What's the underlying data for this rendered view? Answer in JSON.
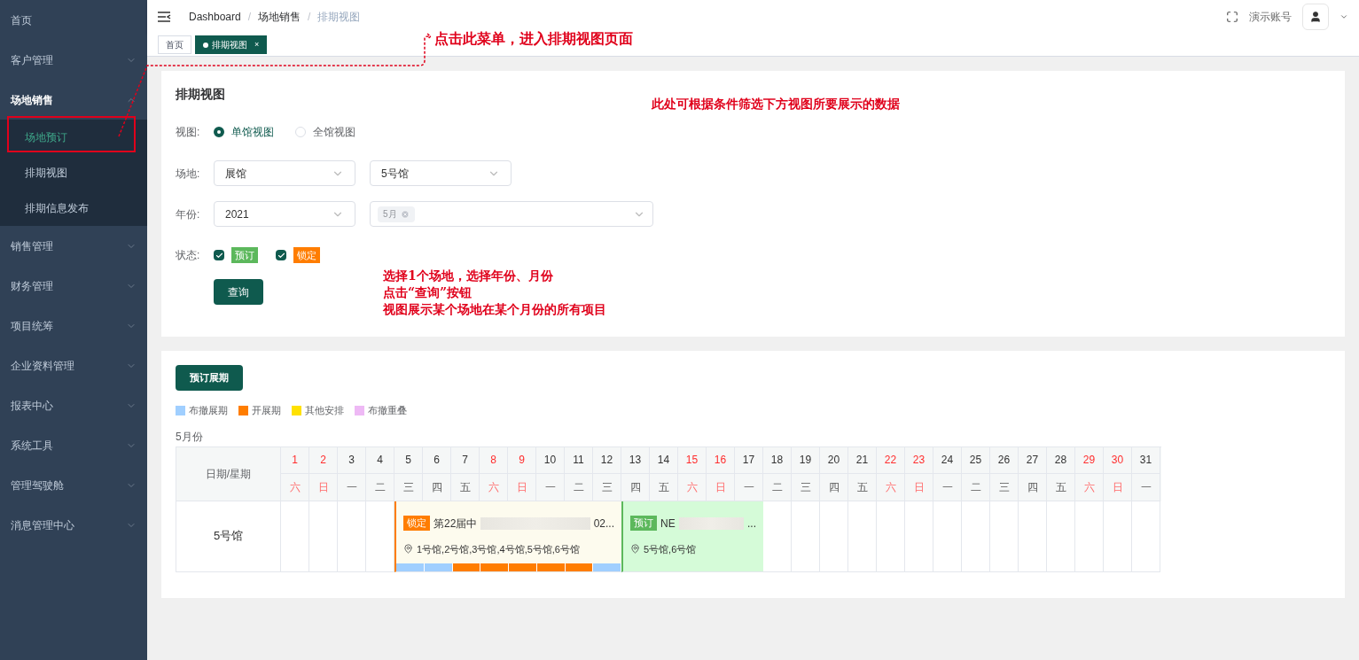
{
  "sidebar": {
    "items": [
      {
        "label": "首页",
        "expanded": false,
        "has_children": false
      },
      {
        "label": "客户管理",
        "expanded": false,
        "has_children": true
      },
      {
        "label": "场地销售",
        "expanded": true,
        "has_children": true,
        "children": [
          {
            "label": "场地预订",
            "selected": true
          },
          {
            "label": "排期视图",
            "selected": false
          },
          {
            "label": "排期信息发布",
            "selected": false
          }
        ]
      },
      {
        "label": "销售管理",
        "expanded": false,
        "has_children": true
      },
      {
        "label": "财务管理",
        "expanded": false,
        "has_children": true
      },
      {
        "label": "项目统筹",
        "expanded": false,
        "has_children": true
      },
      {
        "label": "企业资料管理",
        "expanded": false,
        "has_children": true
      },
      {
        "label": "报表中心",
        "expanded": false,
        "has_children": true
      },
      {
        "label": "系统工具",
        "expanded": false,
        "has_children": true
      },
      {
        "label": "管理驾驶舱",
        "expanded": false,
        "has_children": true
      },
      {
        "label": "消息管理中心",
        "expanded": false,
        "has_children": true
      }
    ]
  },
  "header": {
    "breadcrumb": [
      "Dashboard",
      "场地销售",
      "排期视图"
    ],
    "separator": "/",
    "account": "演示账号"
  },
  "tags": [
    {
      "label": "首页",
      "selected": false,
      "closable": false
    },
    {
      "label": "排期视图",
      "selected": true,
      "closable": true,
      "close": "×"
    }
  ],
  "filter": {
    "title": "排期视图",
    "view": {
      "label": "视图:",
      "options": [
        {
          "label": "单馆视图",
          "selected": true
        },
        {
          "label": "全馆视图",
          "selected": false
        }
      ]
    },
    "venue": {
      "label": "场地:",
      "selects": [
        {
          "value": "展馆"
        },
        {
          "value": "5号馆"
        }
      ]
    },
    "year": {
      "label": "年份:",
      "value": "2021",
      "months": [
        "5月"
      ]
    },
    "status": {
      "label": "状态:",
      "options": [
        {
          "label": "预订",
          "checked": true,
          "kind": "booked"
        },
        {
          "label": "锁定",
          "checked": true,
          "kind": "locked"
        }
      ]
    },
    "query_button": "查询"
  },
  "schedule": {
    "book_button": "预订展期",
    "legend": [
      {
        "label": "布撤展期",
        "color": "#a0cfff"
      },
      {
        "label": "开展期",
        "color": "#ff7d00"
      },
      {
        "label": "其他安排",
        "color": "#ffe100"
      },
      {
        "label": "布撤重叠",
        "color": "#eeb9f5"
      }
    ],
    "month": "5月份",
    "corner": "日期/星期",
    "days": [
      {
        "day": "1",
        "weekday": "六",
        "weekend": true
      },
      {
        "day": "2",
        "weekday": "日",
        "weekend": true
      },
      {
        "day": "3",
        "weekday": "一",
        "weekend": false
      },
      {
        "day": "4",
        "weekday": "二",
        "weekend": false
      },
      {
        "day": "5",
        "weekday": "三",
        "weekend": false
      },
      {
        "day": "6",
        "weekday": "四",
        "weekend": false
      },
      {
        "day": "7",
        "weekday": "五",
        "weekend": false
      },
      {
        "day": "8",
        "weekday": "六",
        "weekend": true
      },
      {
        "day": "9",
        "weekday": "日",
        "weekend": true
      },
      {
        "day": "10",
        "weekday": "一",
        "weekend": false
      },
      {
        "day": "11",
        "weekday": "二",
        "weekend": false
      },
      {
        "day": "12",
        "weekday": "三",
        "weekend": false
      },
      {
        "day": "13",
        "weekday": "四",
        "weekend": false
      },
      {
        "day": "14",
        "weekday": "五",
        "weekend": false
      },
      {
        "day": "15",
        "weekday": "六",
        "weekend": true
      },
      {
        "day": "16",
        "weekday": "日",
        "weekend": true
      },
      {
        "day": "17",
        "weekday": "一",
        "weekend": false
      },
      {
        "day": "18",
        "weekday": "二",
        "weekend": false
      },
      {
        "day": "19",
        "weekday": "三",
        "weekend": false
      },
      {
        "day": "20",
        "weekday": "四",
        "weekend": false
      },
      {
        "day": "21",
        "weekday": "五",
        "weekend": false
      },
      {
        "day": "22",
        "weekday": "六",
        "weekend": true
      },
      {
        "day": "23",
        "weekday": "日",
        "weekend": true
      },
      {
        "day": "24",
        "weekday": "一",
        "weekend": false
      },
      {
        "day": "25",
        "weekday": "二",
        "weekend": false
      },
      {
        "day": "26",
        "weekday": "三",
        "weekend": false
      },
      {
        "day": "27",
        "weekday": "四",
        "weekend": false
      },
      {
        "day": "28",
        "weekday": "五",
        "weekend": false
      },
      {
        "day": "29",
        "weekday": "六",
        "weekend": true
      },
      {
        "day": "30",
        "weekday": "日",
        "weekend": true
      },
      {
        "day": "31",
        "weekday": "一",
        "weekend": false
      }
    ],
    "rows": [
      {
        "venue": "5号馆",
        "segments": [
          {
            "kind": "empty"
          },
          {
            "kind": "empty"
          },
          {
            "kind": "empty"
          },
          {
            "kind": "empty"
          },
          {
            "kind": "event",
            "locked": true,
            "tag": "锁定",
            "title_start": "第22届中",
            "title_end": "02...",
            "location": "1号馆,2号馆,3号馆,4号馆,5号馆,6号馆",
            "phases": [
              {
                "kind": "setup"
              },
              {
                "kind": "setup"
              },
              {
                "kind": "open"
              },
              {
                "kind": "open"
              },
              {
                "kind": "open"
              },
              {
                "kind": "open"
              },
              {
                "kind": "open"
              },
              {
                "kind": "setup"
              }
            ]
          },
          {
            "kind": "event",
            "locked": false,
            "tag": "预订",
            "title_start": "NE",
            "title_end": "...",
            "location": "5号馆,6号馆",
            "phases": [
              {
                "kind": "none"
              },
              {
                "kind": "none"
              },
              {
                "kind": "none"
              },
              {
                "kind": "none"
              },
              {
                "kind": "none"
              }
            ]
          },
          {
            "kind": "empty"
          },
          {
            "kind": "empty"
          },
          {
            "kind": "empty"
          },
          {
            "kind": "empty"
          },
          {
            "kind": "empty"
          },
          {
            "kind": "empty"
          },
          {
            "kind": "empty"
          },
          {
            "kind": "empty"
          },
          {
            "kind": "empty"
          },
          {
            "kind": "empty"
          },
          {
            "kind": "empty"
          },
          {
            "kind": "empty"
          },
          {
            "kind": "empty"
          },
          {
            "kind": "empty"
          }
        ]
      }
    ]
  },
  "annotations": {
    "menu_note": "点击此菜单，进入排期视图页面",
    "filter_note": "此处可根据条件筛选下方视图所要展示的数据",
    "query_note": [
      "选择1个场地，选择年份、月份",
      "点击“查询”按钮",
      "视图展示某个场地在某个月份的所有项目"
    ]
  }
}
